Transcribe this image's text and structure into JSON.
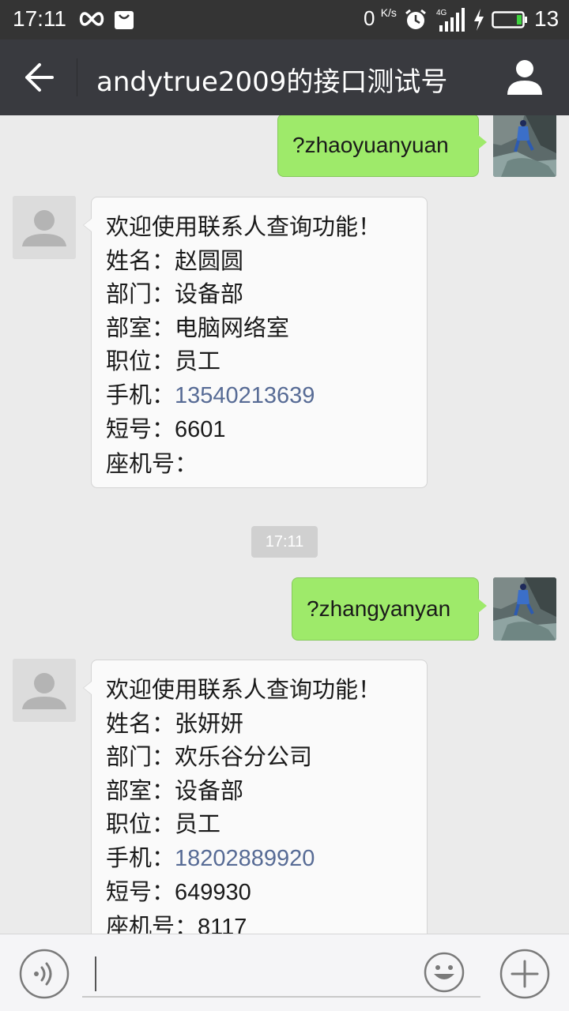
{
  "status_bar": {
    "time": "17:11",
    "net_speed": "0",
    "net_speed_unit": "K/s",
    "network": "4G",
    "battery_level": "13",
    "icons": [
      "infinity-icon",
      "bag-icon",
      "alarm-icon",
      "signal-icon",
      "charging-icon",
      "battery-icon"
    ]
  },
  "header": {
    "title": "andytrue2009的接口测试号",
    "back_icon": "back-arrow-icon",
    "profile_icon": "person-icon"
  },
  "messages": [
    {
      "type": "outgoing",
      "text": "?zhaoyuanyuan"
    },
    {
      "type": "incoming",
      "lines": [
        {
          "label": "欢迎使用联系人查询功能！",
          "value": ""
        },
        {
          "label": "姓名：",
          "value": "赵圆圆"
        },
        {
          "label": "部门：",
          "value": "设备部"
        },
        {
          "label": "部室：",
          "value": "电脑网络室"
        },
        {
          "label": "职位：",
          "value": "员工"
        },
        {
          "label": "手机：",
          "value": "13540213639"
        },
        {
          "label": "短号：",
          "value": "6601"
        },
        {
          "label": "座机号：",
          "value": ""
        }
      ]
    },
    {
      "type": "timestamp",
      "text": "17:11"
    },
    {
      "type": "outgoing",
      "text": "?zhangyanyan"
    },
    {
      "type": "incoming",
      "lines": [
        {
          "label": "欢迎使用联系人查询功能！",
          "value": ""
        },
        {
          "label": "姓名：",
          "value": "张妍妍"
        },
        {
          "label": "部门：",
          "value": "欢乐谷分公司"
        },
        {
          "label": "部室：",
          "value": "设备部"
        },
        {
          "label": "职位：",
          "value": "员工"
        },
        {
          "label": "手机：",
          "value": "18202889920"
        },
        {
          "label": "短号：",
          "value": "649930"
        },
        {
          "label": "座机号：",
          "value": "8117"
        }
      ]
    }
  ],
  "input_bar": {
    "value": "",
    "placeholder": "",
    "icons": [
      "voice-icon",
      "emoji-icon",
      "plus-icon"
    ]
  },
  "colors": {
    "status_bar": "#343434",
    "title_bar": "#393a3f",
    "chat_bg": "#ebebeb",
    "outgoing_bubble": "#9eea6a",
    "incoming_bubble": "#fafafa",
    "link": "#576b95"
  }
}
